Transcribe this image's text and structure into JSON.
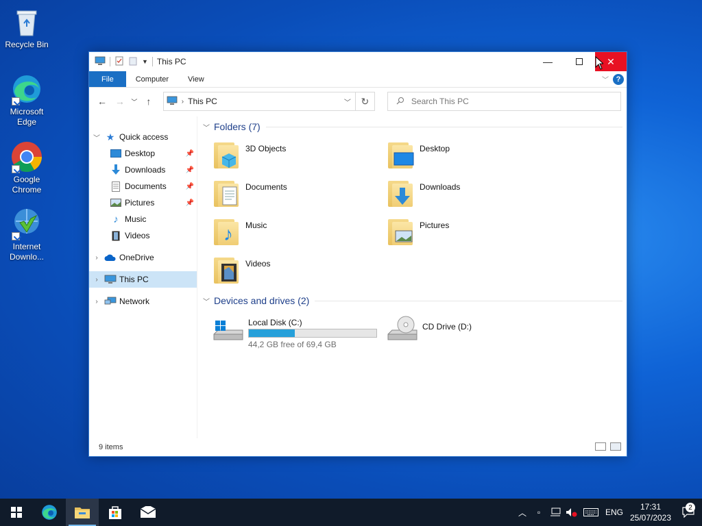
{
  "desktop": {
    "icons": [
      {
        "label": "Recycle Bin"
      },
      {
        "label": "Microsoft Edge"
      },
      {
        "label": "Google Chrome"
      },
      {
        "label": "Internet Downlo..."
      }
    ]
  },
  "window": {
    "title": "This PC",
    "ribbon_tabs": [
      "File",
      "Computer",
      "View"
    ],
    "help_label": "?",
    "address": "This PC",
    "search_placeholder": "Search This PC",
    "sidebar": {
      "quick_access": "Quick access",
      "quick_items": [
        "Desktop",
        "Downloads",
        "Documents",
        "Pictures",
        "Music",
        "Videos"
      ],
      "onedrive": "OneDrive",
      "this_pc": "This PC",
      "network": "Network"
    },
    "folders_header": "Folders (7)",
    "folders": [
      "3D Objects",
      "Desktop",
      "Documents",
      "Downloads",
      "Music",
      "Pictures",
      "Videos"
    ],
    "drives_header": "Devices and drives (2)",
    "drives": [
      {
        "name": "Local Disk (C:)",
        "free": "44,2 GB free of 69,4 GB",
        "used_fraction": 0.36
      },
      {
        "name": "CD Drive (D:)"
      }
    ],
    "status": "9 items"
  },
  "taskbar": {
    "language": "ENG",
    "time": "17:31",
    "date": "25/07/2023",
    "notifications": "2"
  },
  "colors": {
    "accent": "#1a6fc4",
    "close": "#e81123",
    "selection": "#cce4f7",
    "drive_bar": "#26a0da",
    "taskbar": "#101b2a"
  }
}
